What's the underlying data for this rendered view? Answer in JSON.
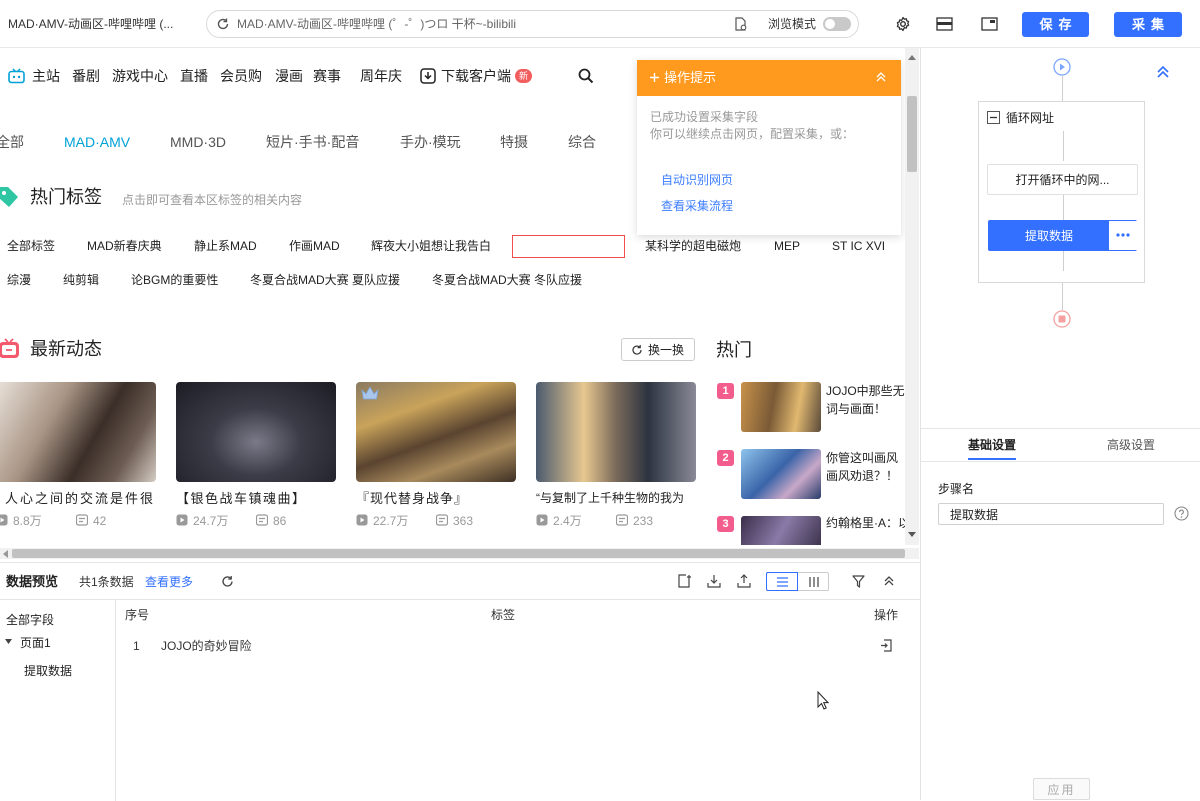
{
  "browser": {
    "tab_title": "MAD·AMV-动画区-哔哩哔哩 (...",
    "address": "MAD·AMV-动画区-哔哩哔哩 (゜-゜)つロ 干杯~-bilibili",
    "browse_mode_label": "浏览模式",
    "browse_mode_on": false,
    "save_label": "保存",
    "collect_label": "采集"
  },
  "site": {
    "nav": [
      "主站",
      "番剧",
      "游戏中心",
      "直播",
      "会员购",
      "漫画",
      "赛事",
      "周年庆"
    ],
    "download_label": "下载客户端",
    "new_badge": "新",
    "categories": [
      "全部",
      "MAD·AMV",
      "MMD·3D",
      "短片·手书·配音",
      "手办·模玩",
      "特摄",
      "综合"
    ],
    "active_category_index": 1,
    "hot_tags": {
      "title": "热门标签",
      "subtitle": "点击即可查看本区标签的相关内容",
      "row1": [
        "全部标签",
        "MAD新春庆典",
        "静止系MAD",
        "作画MAD",
        "辉夜大小姐想让我告白",
        "某科学的超电磁炮",
        "MEP",
        "ST IC XVI"
      ],
      "row2": [
        "综漫",
        "纯剪辑",
        "论BGM的重要性",
        "冬夏合战MAD大赛 夏队应援",
        "冬夏合战MAD大赛 冬队应援"
      ]
    },
    "latest": {
      "title": "最新动态",
      "refresh_label": "换一换",
      "cards": [
        {
          "title": "人心之间的交流是件很",
          "plays": "8.8万",
          "comments": "42"
        },
        {
          "title": "【银色战车镇魂曲】",
          "plays": "24.7万",
          "comments": "86"
        },
        {
          "title": "『现代替身战争』",
          "plays": "22.7万",
          "comments": "363"
        },
        {
          "title": "“与复制了上千种生物的我为",
          "plays": "2.4万",
          "comments": "233"
        }
      ]
    },
    "hot": {
      "title": "热门",
      "items": [
        {
          "rank": "1",
          "lines": [
            "JOJO中那些无",
            "词与画面！"
          ]
        },
        {
          "rank": "2",
          "lines": [
            "你管这叫画风",
            "画风劝退？！"
          ]
        },
        {
          "rank": "3",
          "lines": [
            "约翰格里·A：以"
          ]
        }
      ]
    }
  },
  "tooltip": {
    "title": "操作提示",
    "message": "已成功设置采集字段",
    "hint": "你可以继续点击网页，配置采集，或：",
    "links": [
      "自动识别网页",
      "查看采集流程"
    ]
  },
  "preview": {
    "title": "数据预览",
    "count_text": "共1条数据",
    "more_label": "查看更多",
    "tree": {
      "root": "全部字段",
      "page": "页面1",
      "field": "提取数据"
    },
    "columns": [
      "序号",
      "标签",
      "操作"
    ],
    "rows": [
      {
        "index": "1",
        "tag": "JOJO的奇妙冒险"
      }
    ]
  },
  "workflow": {
    "loop_label": "循环网址",
    "open_loop_label": "打开循环中的网...",
    "extract_label": "提取数据"
  },
  "settings": {
    "tabs": [
      "基础设置",
      "高级设置"
    ],
    "active_tab_index": 0,
    "step_name_label": "步骤名",
    "step_name_value": "提取数据",
    "apply_label": "应用"
  },
  "colors": {
    "accent": "#3370ff",
    "bili": "#00a1d6",
    "orange": "#ff9a1f",
    "pink": "#f25d8e",
    "red": "#f04c4c"
  }
}
